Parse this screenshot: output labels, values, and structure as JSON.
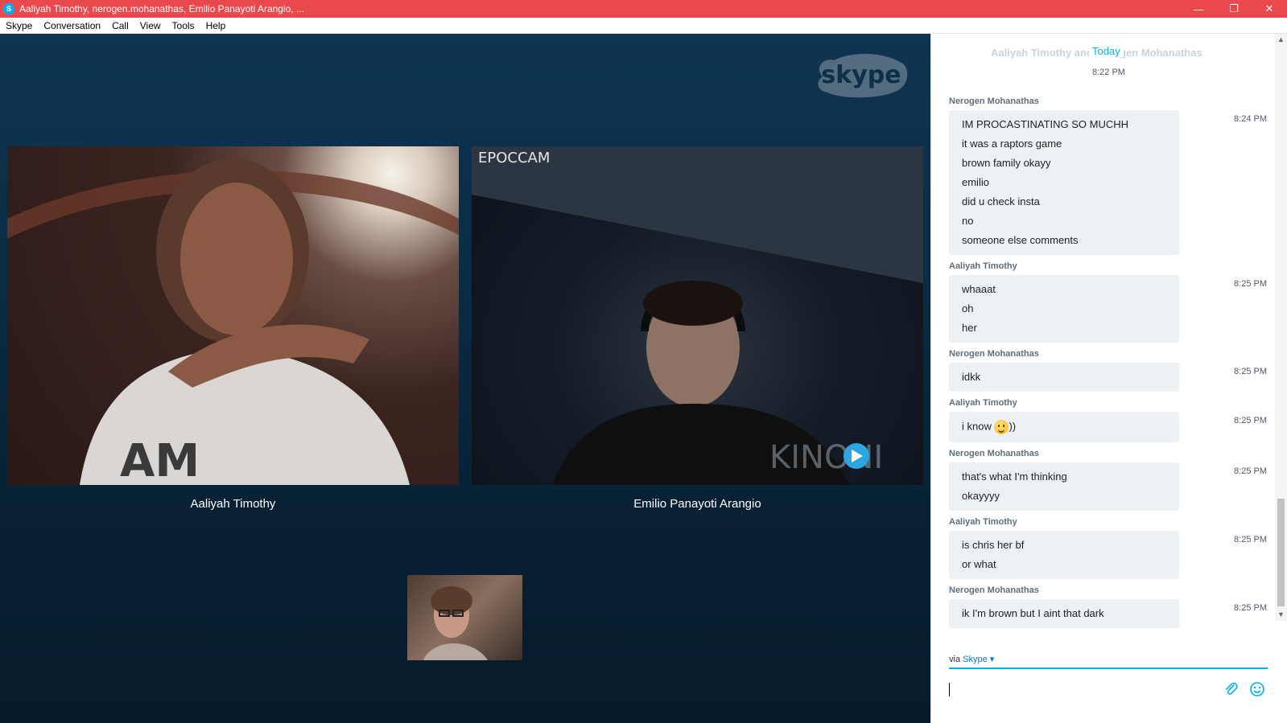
{
  "window": {
    "title": "Aaliyah Timothy, nerogen.mohanathas, Emilio Panayoti Arangio, ...",
    "app_icon": "skype-icon"
  },
  "menu": [
    "Skype",
    "Conversation",
    "Call",
    "View",
    "Tools",
    "Help"
  ],
  "call": {
    "logo_text": "skype",
    "tiles": [
      {
        "name": "Aaliyah Timothy"
      },
      {
        "name": "Emilio Panayoti Arangio",
        "overlay_text": "EPOCCAM",
        "watermark": "KINONI"
      }
    ]
  },
  "chat": {
    "header_names": "Aaliyah Timothy and Nerogen Mohanathas",
    "day_label": "Today",
    "first_time": "8:22 PM",
    "groups": [
      {
        "sender": "Nerogen Mohanathas",
        "time": "8:24 PM",
        "lines": [
          "IM PROCASTINATING SO MUCHH",
          "it was a raptors game",
          "brown family okayy",
          "emilio",
          "did u check insta",
          "no",
          "someone else comments"
        ]
      },
      {
        "sender": "Aaliyah Timothy",
        "time": "8:25 PM",
        "lines": [
          "whaaat",
          "oh",
          "her"
        ]
      },
      {
        "sender": "Nerogen Mohanathas",
        "time": "8:25 PM",
        "lines": [
          "idkk"
        ]
      },
      {
        "sender": "Aaliyah Timothy",
        "time": "8:25 PM",
        "lines": [
          "i know "
        ],
        "emoji_suffix": "))"
      },
      {
        "sender": "Nerogen Mohanathas",
        "time": "8:25 PM",
        "lines": [
          "that's what I'm thinking",
          "okayyyy"
        ]
      },
      {
        "sender": "Aaliyah Timothy",
        "time": "8:25 PM",
        "lines": [
          "is chris her bf",
          "or what"
        ]
      },
      {
        "sender": "Nerogen Mohanathas",
        "time": "8:25 PM",
        "lines": [
          "ik I'm brown but I aint that dark"
        ]
      }
    ],
    "via_label": "via",
    "via_link": "Skype",
    "compose_value": ""
  },
  "colors": {
    "titlebar": "#e9484d",
    "accent": "#00aff0",
    "bubble": "#eef1f4"
  }
}
